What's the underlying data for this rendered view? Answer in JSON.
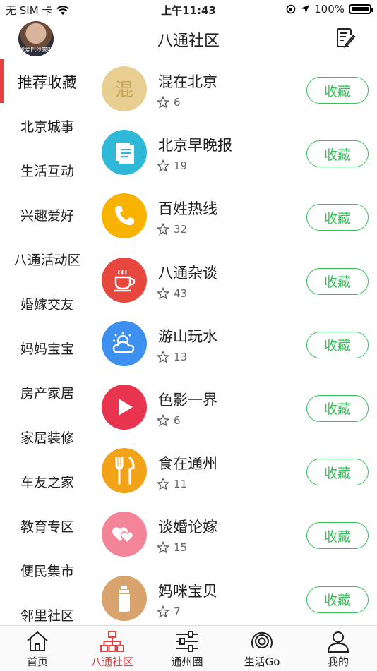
{
  "status": {
    "carrier": "无 SIM 卡",
    "time": "上午11:43",
    "battery": "100%"
  },
  "header": {
    "title": "八通社区",
    "avatar_caption": "我爱巴沙来吧"
  },
  "sidebar": {
    "items": [
      {
        "label": "推荐收藏",
        "active": true
      },
      {
        "label": "北京城事"
      },
      {
        "label": "生活互动"
      },
      {
        "label": "兴趣爱好"
      },
      {
        "label": "八通活动区"
      },
      {
        "label": "婚嫁交友"
      },
      {
        "label": "妈妈宝宝"
      },
      {
        "label": "房产家居"
      },
      {
        "label": "家居装修"
      },
      {
        "label": "车友之家"
      },
      {
        "label": "教育专区"
      },
      {
        "label": "便民集市"
      },
      {
        "label": "邻里社区"
      }
    ]
  },
  "list": {
    "fav_label": "收藏",
    "items": [
      {
        "name": "混在北京",
        "count": "6",
        "icon": "hun-badge-icon",
        "color": "#e8cf91"
      },
      {
        "name": "北京早晚报",
        "count": "19",
        "icon": "newspaper-icon",
        "color": "#2fb8d8"
      },
      {
        "name": "百姓热线",
        "count": "32",
        "icon": "phone-icon",
        "color": "#f7b300"
      },
      {
        "name": "八通杂谈",
        "count": "43",
        "icon": "coffee-icon",
        "color": "#e8473e"
      },
      {
        "name": "游山玩水",
        "count": "13",
        "icon": "weather-icon",
        "color": "#3d8ff0"
      },
      {
        "name": "色影一界",
        "count": "6",
        "icon": "play-icon",
        "color": "#e8344f"
      },
      {
        "name": "食在通州",
        "count": "11",
        "icon": "utensils-icon",
        "color": "#f3a31a"
      },
      {
        "name": "谈婚论嫁",
        "count": "15",
        "icon": "hearts-icon",
        "color": "#f48598"
      },
      {
        "name": "妈咪宝贝",
        "count": "7",
        "icon": "bottle-icon",
        "color": "#d9a36e"
      }
    ]
  },
  "tabbar": {
    "items": [
      {
        "label": "首页",
        "icon": "home-icon"
      },
      {
        "label": "八通社区",
        "icon": "network-icon",
        "active": true
      },
      {
        "label": "通州圈",
        "icon": "sliders-icon"
      },
      {
        "label": "生活Go",
        "icon": "target-icon"
      },
      {
        "label": "我的",
        "icon": "user-icon"
      }
    ]
  }
}
